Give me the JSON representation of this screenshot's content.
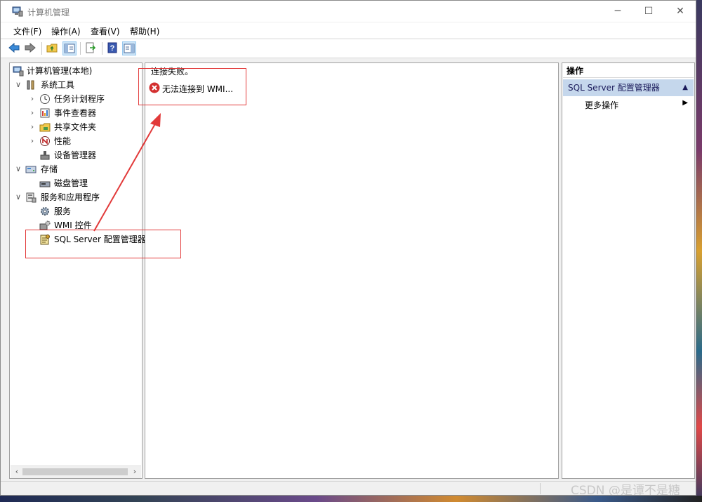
{
  "window": {
    "title": "计算机管理"
  },
  "window_buttons": {
    "minimize": "─",
    "maximize": "☐",
    "close": "✕"
  },
  "menu": [
    "文件(F)",
    "操作(A)",
    "查看(V)",
    "帮助(H)"
  ],
  "toolbar": [
    "back-icon",
    "forward-icon",
    "up-folder-icon",
    "show-hide-tree-icon",
    "export-list-icon",
    "help-icon",
    "show-hide-action-pane-icon"
  ],
  "tree": {
    "root": "计算机管理(本地)",
    "system_tools": "系统工具",
    "task_scheduler": "任务计划程序",
    "event_viewer": "事件查看器",
    "shared_folders": "共享文件夹",
    "performance": "性能",
    "device_manager": "设备管理器",
    "storage": "存储",
    "disk_management": "磁盘管理",
    "services_apps": "服务和应用程序",
    "services": "服务",
    "wmi_control": "WMI 控件",
    "sql_server": "SQL Server 配置管理器"
  },
  "content": {
    "message": "连接失败。",
    "error_item": "无法连接到 WMI..."
  },
  "actions": {
    "header": "操作",
    "section": "SQL Server 配置管理器",
    "more": "更多操作"
  },
  "watermark": "CSDN @是谭不是糖",
  "colors": {
    "selection": "#c5d7ec",
    "annotation": "#e23a3a",
    "error": "#d32f2f"
  }
}
